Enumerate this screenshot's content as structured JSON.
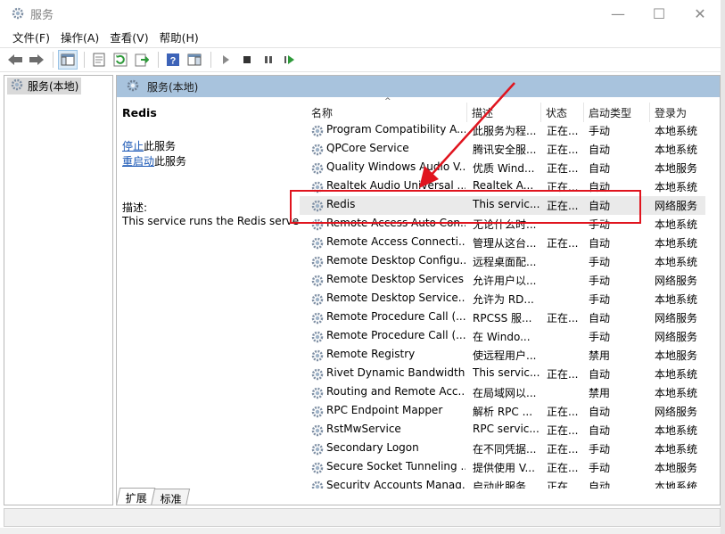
{
  "window": {
    "title": "服务",
    "controls": {
      "minimize": "—",
      "maximize": "☐",
      "close": "✕"
    }
  },
  "menu": [
    "文件(F)",
    "操作(A)",
    "查看(V)",
    "帮助(H)"
  ],
  "tree": {
    "item": "服务(本地)"
  },
  "panel": {
    "header": "服务(本地)",
    "selected_service": "Redis",
    "actions": {
      "stop_link": "停止",
      "stop_suffix": "此服务",
      "restart_link": "重启动",
      "restart_suffix": "此服务"
    },
    "description_label": "描述:",
    "description_text": "This service runs the Redis server"
  },
  "table": {
    "headers": [
      "名称",
      "描述",
      "状态",
      "启动类型",
      "登录为"
    ],
    "rows": [
      [
        "Program Compatibility A...",
        "此服务为程...",
        "正在...",
        "手动",
        "本地系统"
      ],
      [
        "QPCore Service",
        "腾讯安全服...",
        "正在...",
        "自动",
        "本地系统"
      ],
      [
        "Quality Windows Audio V...",
        "优质 Wind...",
        "正在...",
        "自动",
        "本地服务"
      ],
      [
        "Realtek Audio Universal ...",
        "Realtek A...",
        "正在...",
        "自动",
        "本地系统"
      ],
      [
        "Redis",
        "This servic...",
        "正在...",
        "自动",
        "网络服务"
      ],
      [
        "Remote Access Auto Con...",
        "无论什么时...",
        "",
        "手动",
        "本地系统"
      ],
      [
        "Remote Access Connecti...",
        "管理从这台...",
        "正在...",
        "自动",
        "本地系统"
      ],
      [
        "Remote Desktop Configu...",
        "远程桌面配...",
        "",
        "手动",
        "本地系统"
      ],
      [
        "Remote Desktop Services",
        "允许用户以...",
        "",
        "手动",
        "网络服务"
      ],
      [
        "Remote Desktop Service...",
        "允许为 RD...",
        "",
        "手动",
        "本地系统"
      ],
      [
        "Remote Procedure Call (...",
        "RPCSS 服...",
        "正在...",
        "自动",
        "网络服务"
      ],
      [
        "Remote Procedure Call (...",
        "在 Windo...",
        "",
        "手动",
        "网络服务"
      ],
      [
        "Remote Registry",
        "使远程用户...",
        "",
        "禁用",
        "本地服务"
      ],
      [
        "Rivet Dynamic Bandwidth...",
        "This servic...",
        "正在...",
        "自动",
        "本地系统"
      ],
      [
        "Routing and Remote Acc...",
        "在局域网以...",
        "",
        "禁用",
        "本地系统"
      ],
      [
        "RPC Endpoint Mapper",
        "解析 RPC ...",
        "正在...",
        "自动",
        "网络服务"
      ],
      [
        "RstMwService",
        "RPC servic...",
        "正在...",
        "自动",
        "本地系统"
      ],
      [
        "Secondary Logon",
        "在不同凭据...",
        "正在...",
        "手动",
        "本地系统"
      ],
      [
        "Secure Socket Tunneling ...",
        "提供使用 V...",
        "正在...",
        "手动",
        "本地服务"
      ],
      [
        "Security Accounts Manag...",
        "启动此服务...",
        "正在...",
        "自动",
        "本地系统"
      ]
    ],
    "selected_index": 4
  },
  "tabs": [
    "扩展",
    "标准"
  ],
  "colors": {
    "highlight": "#e0141e",
    "panel_header": "#a8c3dd",
    "link": "#1a57b5"
  }
}
